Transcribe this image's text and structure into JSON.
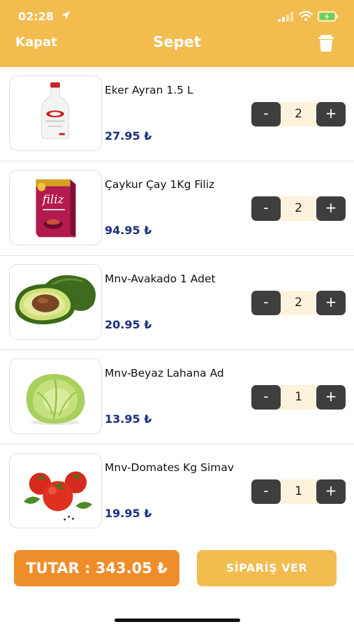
{
  "status_bar": {
    "time": "02:28"
  },
  "nav": {
    "close_label": "Kapat",
    "title": "Sepet"
  },
  "items": [
    {
      "name": "Eker Ayran 1.5 L",
      "price": "27.95 ₺",
      "quantity": "2",
      "image": "ayran-bottle"
    },
    {
      "name": "Çaykur Çay 1Kg Filiz",
      "price": "94.95 ₺",
      "quantity": "2",
      "image": "tea-box"
    },
    {
      "name": "Mnv-Avakado 1 Adet",
      "price": "20.95 ₺",
      "quantity": "2",
      "image": "avocado"
    },
    {
      "name": "Mnv-Beyaz Lahana Ad",
      "price": "13.95 ₺",
      "quantity": "1",
      "image": "cabbage"
    },
    {
      "name": "Mnv-Domates Kg Simav",
      "price": "19.95 ₺",
      "quantity": "1",
      "image": "tomatoes"
    }
  ],
  "stepper": {
    "minus_label": "-",
    "plus_label": "+"
  },
  "footer": {
    "total_label": "TUTAR : 343.05 ₺",
    "order_label": "SİPARİŞ VER"
  },
  "colors": {
    "header": "#f2bc4f",
    "total_button": "#f08d2b",
    "price_text": "#1b2f7a",
    "stepper_button": "#3e3e3e"
  }
}
